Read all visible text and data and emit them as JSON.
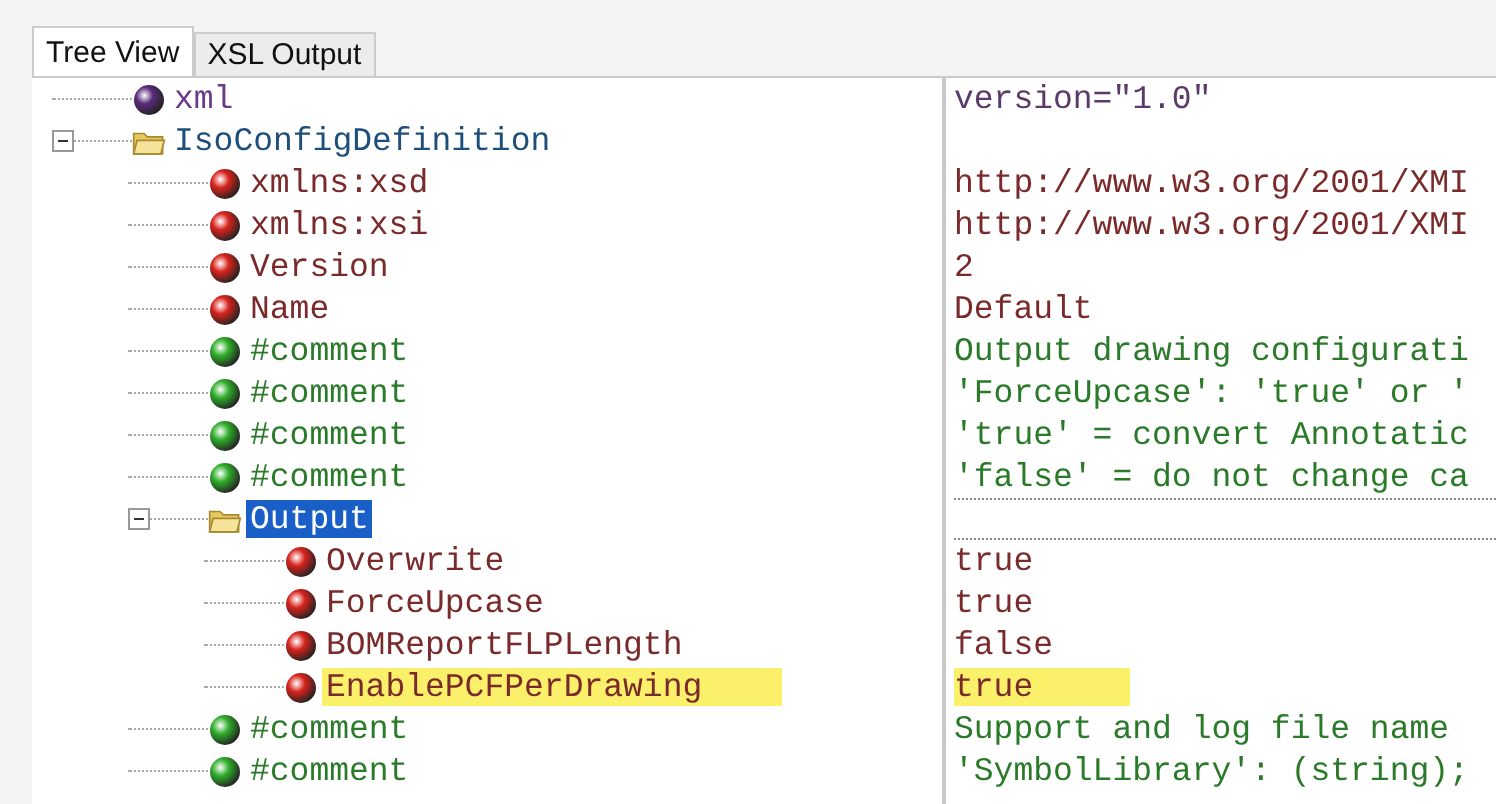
{
  "tabs": [
    {
      "label": "Tree View",
      "selected": true
    },
    {
      "label": "XSL Output",
      "selected": false
    }
  ],
  "tree": [
    {
      "kind": "pi",
      "name": "xml",
      "value": "version=\"1.0\"",
      "selected": false,
      "highlighted": false
    },
    {
      "kind": "element",
      "name": "IsoConfigDefinition",
      "expanded": true,
      "selected": false,
      "highlighted": false,
      "children": [
        {
          "kind": "attribute",
          "name": "xmlns:xsd",
          "value": "http://www.w3.org/2001/XMI",
          "selected": false,
          "highlighted": false
        },
        {
          "kind": "attribute",
          "name": "xmlns:xsi",
          "value": "http://www.w3.org/2001/XMI",
          "selected": false,
          "highlighted": false
        },
        {
          "kind": "attribute",
          "name": "Version",
          "value": "2",
          "selected": false,
          "highlighted": false
        },
        {
          "kind": "attribute",
          "name": "Name",
          "value": "Default",
          "selected": false,
          "highlighted": false
        },
        {
          "kind": "comment",
          "name": "#comment",
          "value": "Output drawing configurati",
          "selected": false,
          "highlighted": false
        },
        {
          "kind": "comment",
          "name": "#comment",
          "value": "'ForceUpcase': 'true' or '",
          "selected": false,
          "highlighted": false
        },
        {
          "kind": "comment",
          "name": "#comment",
          "value": "'true' = convert Annotatic",
          "selected": false,
          "highlighted": false
        },
        {
          "kind": "comment",
          "name": "#comment",
          "value": "'false' = do not change ca",
          "selected": false,
          "highlighted": false
        },
        {
          "kind": "element",
          "name": "Output",
          "expanded": true,
          "selected": true,
          "highlighted": false,
          "children": [
            {
              "kind": "attribute",
              "name": "Overwrite",
              "value": "true",
              "selected": false,
              "highlighted": false
            },
            {
              "kind": "attribute",
              "name": "ForceUpcase",
              "value": "true",
              "selected": false,
              "highlighted": false
            },
            {
              "kind": "attribute",
              "name": "BOMReportFLPLength",
              "value": "false",
              "selected": false,
              "highlighted": false
            },
            {
              "kind": "attribute",
              "name": "EnablePCFPerDrawing",
              "value": "true",
              "selected": false,
              "highlighted": true
            }
          ]
        },
        {
          "kind": "comment",
          "name": "#comment",
          "value": "Support and log file name",
          "selected": false,
          "highlighted": false
        },
        {
          "kind": "comment",
          "name": "#comment",
          "value": "'SymbolLibrary': (string);",
          "selected": false,
          "highlighted": false
        }
      ]
    }
  ]
}
